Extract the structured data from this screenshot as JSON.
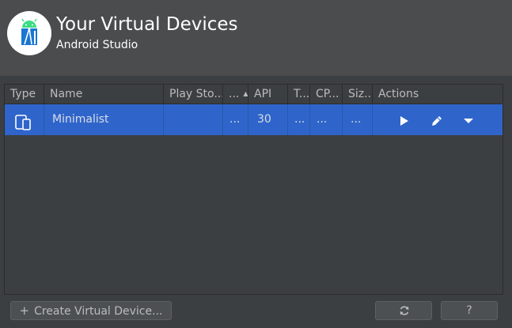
{
  "header": {
    "title": "Your Virtual Devices",
    "subtitle": "Android Studio"
  },
  "table": {
    "columns": [
      "Type",
      "Name",
      "Play Sto...",
      "...",
      "API",
      "T...",
      "CP...",
      "Siz...",
      "Actions"
    ],
    "rows": [
      {
        "type_icon": "phone-tablet-icon",
        "name": "Minimalist",
        "play_store": "",
        "resolution": "...",
        "api": "30",
        "target": "...",
        "cpu": "...",
        "size": "...",
        "actions": [
          "play-icon",
          "pencil-icon",
          "dropdown-arrow-icon"
        ]
      }
    ]
  },
  "footer": {
    "create_label": "Create Virtual Device...",
    "refresh_icon": "refresh-icon",
    "help_label": "?"
  },
  "colors": {
    "selection": "#2f65ca",
    "background": "#3c3f41",
    "header": "#4a4c4e"
  }
}
